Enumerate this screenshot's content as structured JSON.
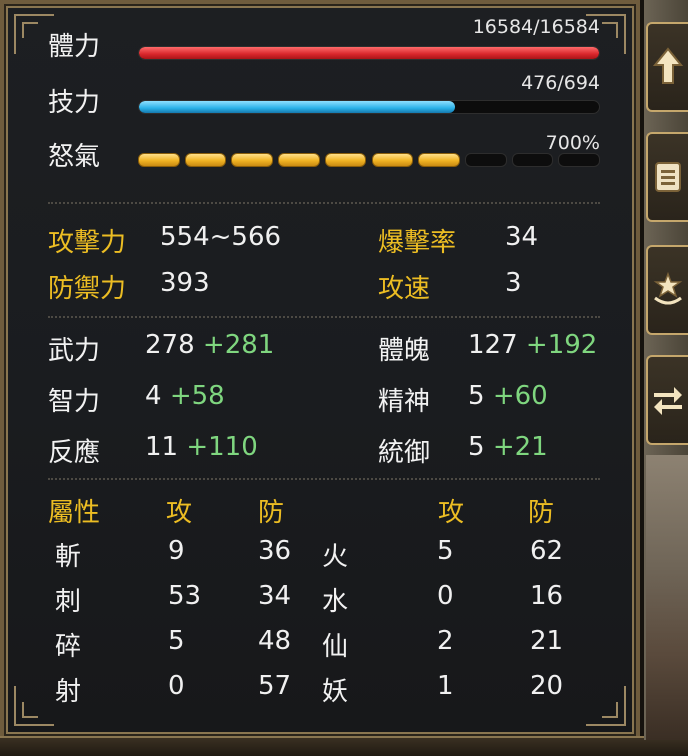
{
  "bars": {
    "hp": {
      "label": "體力",
      "value": 16584,
      "max": 16584,
      "text": "16584/16584"
    },
    "mp": {
      "label": "技力",
      "value": 476,
      "max": 694,
      "text": "476/694"
    },
    "rage": {
      "label": "怒氣",
      "text": "700%",
      "filled_segments": 7,
      "total_segments": 10
    }
  },
  "combat": {
    "attack": {
      "label": "攻擊力",
      "value": "554~566"
    },
    "defense": {
      "label": "防禦力",
      "value": "393"
    },
    "crit": {
      "label": "爆擊率",
      "value": "34"
    },
    "speed": {
      "label": "攻速",
      "value": "3"
    }
  },
  "attributes": [
    {
      "label": "武力",
      "base": "278",
      "bonus": "+281"
    },
    {
      "label": "體魄",
      "base": "127",
      "bonus": "+192"
    },
    {
      "label": "智力",
      "base": "4",
      "bonus": "+58"
    },
    {
      "label": "精神",
      "base": "5",
      "bonus": "+60"
    },
    {
      "label": "反應",
      "base": "11",
      "bonus": "+110"
    },
    {
      "label": "統御",
      "base": "5",
      "bonus": "+21"
    }
  ],
  "elements": {
    "header": {
      "title": "屬性",
      "atk": "攻",
      "def": "防",
      "atk2": "攻",
      "def2": "防"
    },
    "left": [
      {
        "name": "斬",
        "atk": "9",
        "def": "36"
      },
      {
        "name": "刺",
        "atk": "53",
        "def": "34"
      },
      {
        "name": "碎",
        "atk": "5",
        "def": "48"
      },
      {
        "name": "射",
        "atk": "0",
        "def": "57"
      }
    ],
    "right": [
      {
        "name": "火",
        "atk": "5",
        "def": "62"
      },
      {
        "name": "水",
        "atk": "0",
        "def": "16"
      },
      {
        "name": "仙",
        "atk": "2",
        "def": "21"
      },
      {
        "name": "妖",
        "atk": "1",
        "def": "20"
      }
    ]
  },
  "colors": {
    "gold": "#ecbd23",
    "bonus": "#7fd67f",
    "hp": "#d8262b",
    "mp": "#2ab1e8",
    "rage": "#f0b323"
  },
  "side_buttons": [
    "up-arrow-icon",
    "list-icon",
    "star-rank-icon",
    "swap-arrows-icon"
  ]
}
